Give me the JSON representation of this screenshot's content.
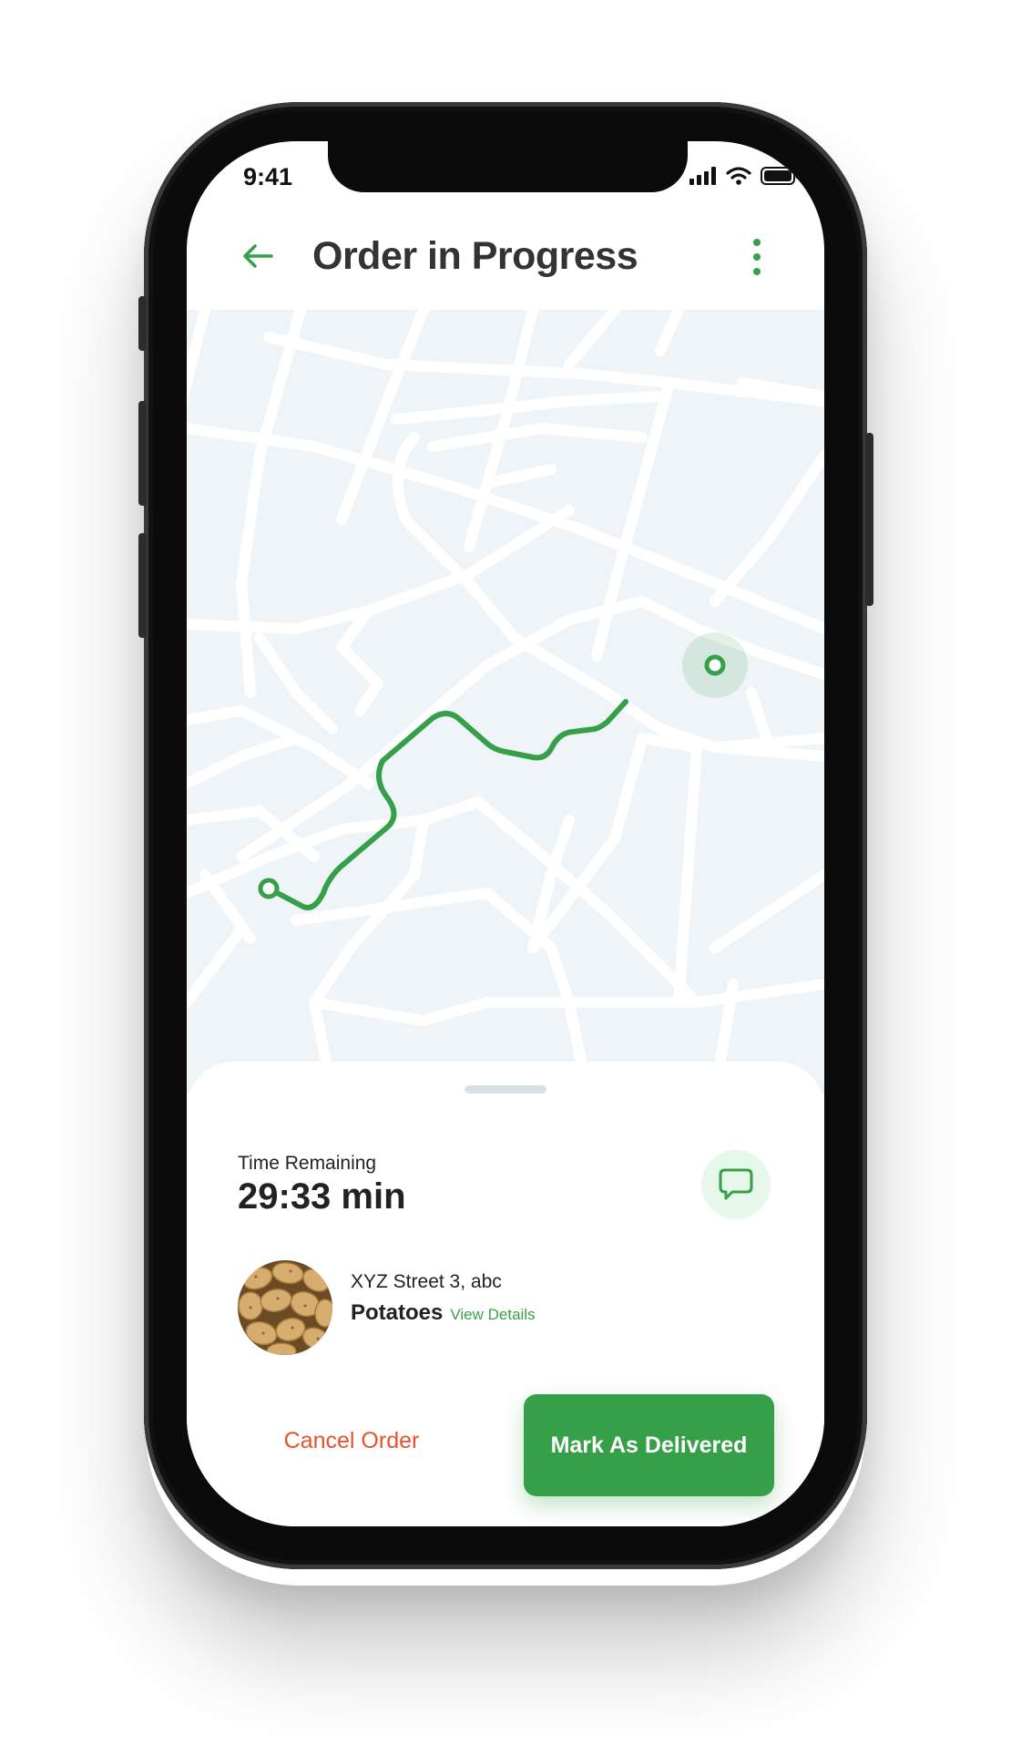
{
  "status_bar": {
    "time": "9:41"
  },
  "header": {
    "title": "Order in Progress"
  },
  "sheet": {
    "time_label": "Time Remaining",
    "time_value": "29:33 min",
    "address": "XYZ Street 3, abc",
    "product_name": "Potatoes",
    "view_details": "View Details"
  },
  "actions": {
    "cancel": "Cancel Order",
    "deliver": "Mark As Delivered"
  },
  "colors": {
    "accent": "#35a047",
    "danger": "#e5522f",
    "map_bg": "#eff4f9"
  },
  "icons": {
    "back": "arrow-left-icon",
    "menu": "more-vertical-icon",
    "chat": "chat-bubble-icon",
    "signal": "signal-icon",
    "wifi": "wifi-icon",
    "battery": "battery-icon"
  }
}
